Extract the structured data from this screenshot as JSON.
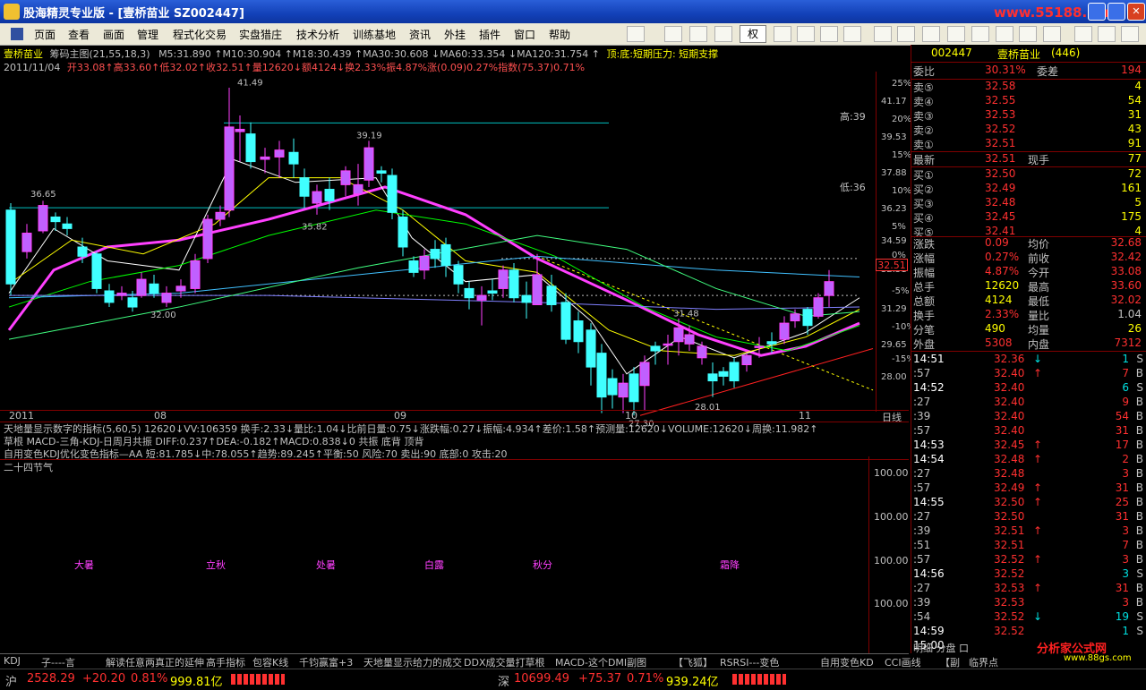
{
  "window": {
    "title": "股海精灵专业版 - [壹桥苗业  SZ002447]",
    "watermark": "www.55188.com"
  },
  "menu": {
    "items": [
      "页面",
      "查看",
      "画面",
      "管理",
      "程式化交易",
      "实盘猎庄",
      "技术分析",
      "训练基地",
      "资讯",
      "外挂",
      "插件",
      "窗口",
      "帮助"
    ],
    "rights_label": "权"
  },
  "chart": {
    "header1": {
      "stock": "壹桥苗业",
      "indicator": "筹码主图(21,55,18,3)",
      "v1": "31.890",
      "v2": "30.904",
      "v3": "30.439",
      "v4": "33.354",
      "ma": "M5:31.890 ↑M10:30.904 ↑M18:30.439 ↑MA30:30.608 ↓MA60:33.354 ↓MA120:31.754 ↑",
      "tail": "顶:底:短期压力: 短期支撑"
    },
    "header2": {
      "date": "2011/11/04",
      "text": "开33.08↑高33.60↑低32.02↑收32.51↑量12620↓额4124↓换2.33%振4.87%涨(0.09)0.27%指数(75.37)0.71%"
    },
    "price_labels": [
      "41.49",
      "39.19",
      "36.65",
      "35.82",
      "32.00",
      "31.48",
      "28.01",
      "27.30"
    ],
    "high_label": "高:39",
    "low_label": "低:36",
    "axis_pct": [
      "25%",
      "20%",
      "15%",
      "10%",
      "5%",
      "0%",
      "-5%",
      "-10%",
      "-15%"
    ],
    "axis_price": [
      "41.17",
      "39.53",
      "37.88",
      "36.23",
      "34.59",
      "32.51",
      "31.29",
      "29.65",
      "28.00"
    ],
    "current_price": "32.51",
    "x_axis": [
      "2011",
      "08",
      "09",
      "10",
      "11"
    ],
    "period": "日线",
    "ind_line1": "天地量显示数字的指标(5,60,5) 12620↓VV:106359 换手:2.33↓量比:1.04↓比前日量:0.75↓涨跌幅:0.27↓振幅:4.934↑差价:1.58↑预测量:12620↓VOLUME:12620↓周换:11.982↑",
    "ind_line2": "草根 MACD-三角-KDJ-日周月共振 DIFF:0.237↑DEA:-0.182↑MACD:0.838↓0 共振 底背 顶背",
    "ind_line3": "自用变色KDJ优化变色指标—AA 短:81.785↓中:78.055↑趋势:89.245↑平衡:50 风险:70 卖出:90 底部:0 攻击:20",
    "jieqi_title": "二十四节气",
    "jieqi": [
      "大暑",
      "立秋",
      "处暑",
      "白露",
      "秋分",
      "霜降"
    ],
    "lower_axis": [
      "100.00",
      "100.00",
      "100.00",
      "100.00"
    ]
  },
  "quote": {
    "code": "002447",
    "name": "壹桥苗业",
    "count": "(446)",
    "weibi": {
      "label": "委比",
      "value": "30.31%",
      "label2": "委差",
      "value2": "194"
    },
    "sells": [
      {
        "label": "卖⑤",
        "price": "32.58",
        "vol": "4"
      },
      {
        "label": "卖④",
        "price": "32.55",
        "vol": "54"
      },
      {
        "label": "卖③",
        "price": "32.53",
        "vol": "31"
      },
      {
        "label": "卖②",
        "price": "32.52",
        "vol": "43"
      },
      {
        "label": "卖①",
        "price": "32.51",
        "vol": "91"
      }
    ],
    "latest": {
      "label": "最新",
      "price": "32.51",
      "label2": "现手",
      "vol": "77"
    },
    "buys": [
      {
        "label": "买①",
        "price": "32.50",
        "vol": "72"
      },
      {
        "label": "买②",
        "price": "32.49",
        "vol": "161"
      },
      {
        "label": "买③",
        "price": "32.48",
        "vol": "5"
      },
      {
        "label": "买④",
        "price": "32.45",
        "vol": "175"
      },
      {
        "label": "买⑤",
        "price": "32.41",
        "vol": "4"
      }
    ],
    "stats": [
      {
        "l1": "涨跌",
        "v1": "0.09",
        "l2": "均价",
        "v2": "32.68"
      },
      {
        "l1": "涨幅",
        "v1": "0.27%",
        "l2": "前收",
        "v2": "32.42"
      },
      {
        "l1": "振幅",
        "v1": "4.87%",
        "l2": "今开",
        "v2": "33.08"
      },
      {
        "l1": "总手",
        "v1": "12620",
        "l2": "最高",
        "v2": "33.60"
      },
      {
        "l1": "总额",
        "v1": "4124",
        "l2": "最低",
        "v2": "32.02"
      },
      {
        "l1": "换手",
        "v1": "2.33%",
        "l2": "量比",
        "v2": "1.04"
      },
      {
        "l1": "分笔",
        "v1": "490",
        "l2": "均量",
        "v2": "26"
      },
      {
        "l1": "外盘",
        "v1": "5308",
        "l2": "内盘",
        "v2": "7312"
      }
    ],
    "ticks": [
      {
        "t": "14:51",
        "p": "32.36",
        "a": "↓",
        "v": "1",
        "s": "S"
      },
      {
        "t": ":57",
        "p": "32.40",
        "a": "↑",
        "v": "7",
        "s": "B"
      },
      {
        "t": "14:52",
        "p": "32.40",
        "a": "",
        "v": "6",
        "s": "S"
      },
      {
        "t": ":27",
        "p": "32.40",
        "a": "",
        "v": "9",
        "s": "B"
      },
      {
        "t": ":39",
        "p": "32.40",
        "a": "",
        "v": "54",
        "s": "B"
      },
      {
        "t": ":57",
        "p": "32.40",
        "a": "",
        "v": "31",
        "s": "B"
      },
      {
        "t": "14:53",
        "p": "32.45",
        "a": "↑",
        "v": "17",
        "s": "B"
      },
      {
        "t": "14:54",
        "p": "32.48",
        "a": "↑",
        "v": "2",
        "s": "B"
      },
      {
        "t": ":27",
        "p": "32.48",
        "a": "",
        "v": "3",
        "s": "B"
      },
      {
        "t": ":57",
        "p": "32.49",
        "a": "↑",
        "v": "31",
        "s": "B"
      },
      {
        "t": "14:55",
        "p": "32.50",
        "a": "↑",
        "v": "25",
        "s": "B"
      },
      {
        "t": ":27",
        "p": "32.50",
        "a": "",
        "v": "31",
        "s": "B"
      },
      {
        "t": ":39",
        "p": "32.51",
        "a": "↑",
        "v": "3",
        "s": "B"
      },
      {
        "t": ":51",
        "p": "32.51",
        "a": "",
        "v": "7",
        "s": "B"
      },
      {
        "t": ":57",
        "p": "32.52",
        "a": "↑",
        "v": "3",
        "s": "B"
      },
      {
        "t": "14:56",
        "p": "32.52",
        "a": "",
        "v": "3",
        "s": "S"
      },
      {
        "t": ":27",
        "p": "32.53",
        "a": "↑",
        "v": "31",
        "s": "B"
      },
      {
        "t": ":39",
        "p": "32.53",
        "a": "",
        "v": "3",
        "s": "B"
      },
      {
        "t": ":54",
        "p": "32.52",
        "a": "↓",
        "v": "19",
        "s": "S"
      },
      {
        "t": "14:59",
        "p": "32.52",
        "a": "",
        "v": "1",
        "s": "S"
      },
      {
        "t": "15:00",
        "p": "",
        "a": "",
        "v": "",
        "s": ""
      }
    ],
    "footer": "明细 分盘 口",
    "logo": "分析家公式网",
    "logo_url": "www.88gs.com"
  },
  "tabs": [
    "KDJ",
    "子----言",
    "解读任意两真正的延伸",
    "高手指标",
    "包容K线",
    "千钧赢富+3",
    "天地量显示给力的成交",
    "DDX成交量打草根",
    "MACD-这个DMI副图",
    "【飞狐】",
    "RSRSI---变色",
    "自用变色KD",
    "CCI画线",
    "【副",
    "临界点"
  ],
  "status": {
    "sh": {
      "label": "沪",
      "index": "2528.29",
      "chg": "+20.20",
      "pct": "0.81%",
      "amt": "999.81亿"
    },
    "sz": {
      "label": "深",
      "index": "10699.49",
      "chg": "+75.37",
      "pct": "0.71%",
      "amt": "939.24亿"
    }
  }
}
